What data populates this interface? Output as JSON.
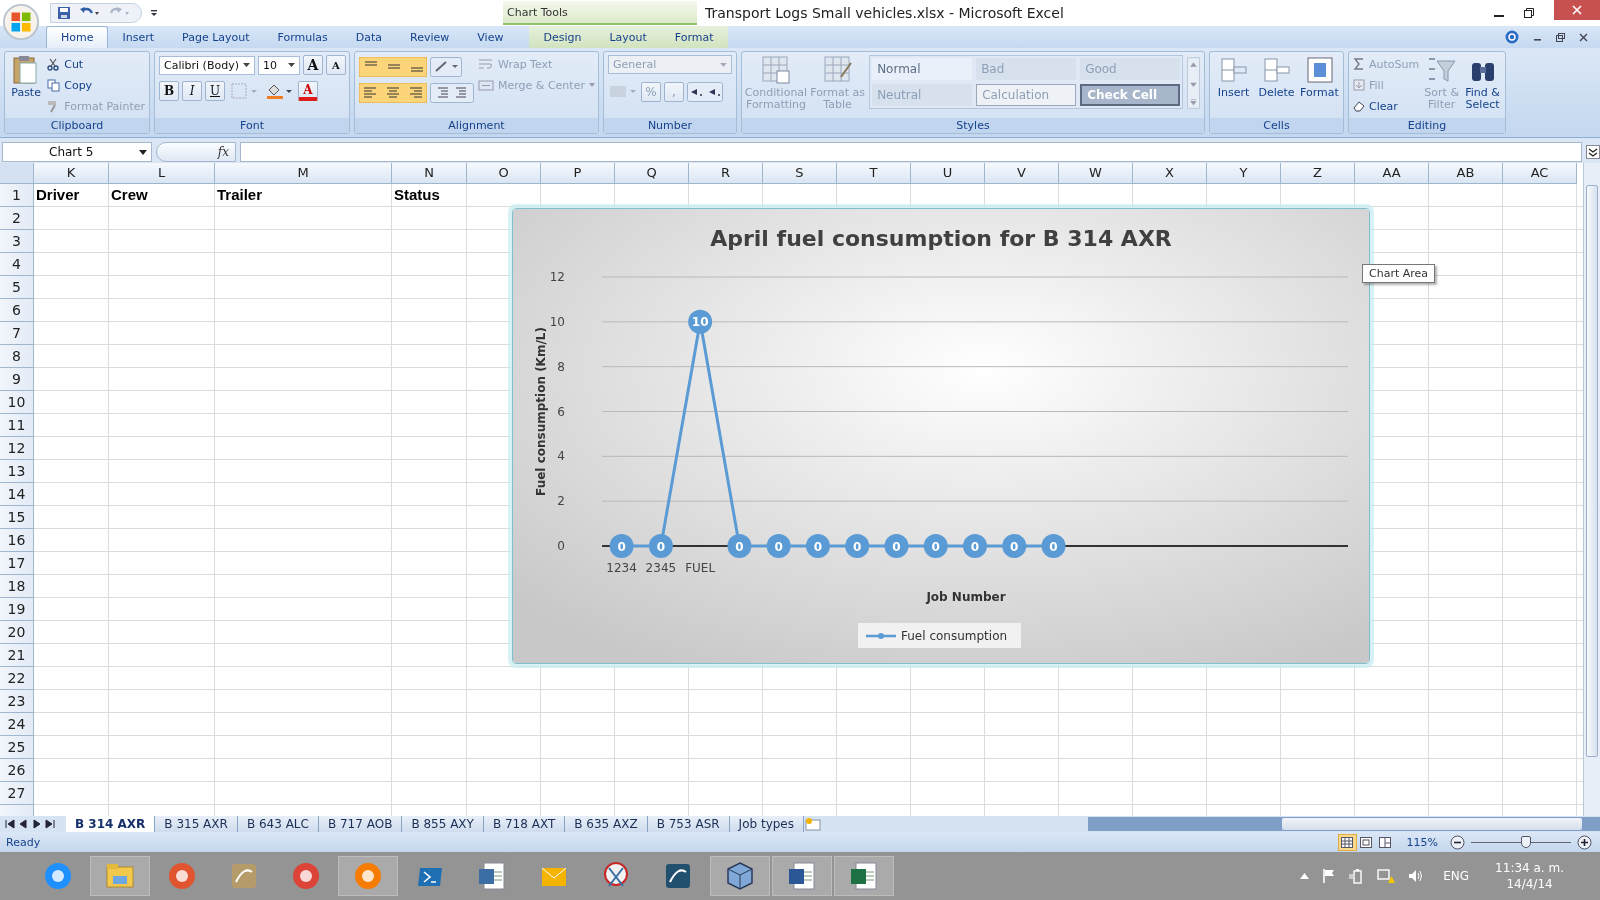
{
  "window": {
    "title": "Transport Logs Small vehicles.xlsx - Microsoft Excel",
    "context_tab": "Chart Tools"
  },
  "tabs": [
    {
      "label": "Home",
      "selected": true,
      "contextual": false
    },
    {
      "label": "Insert",
      "selected": false,
      "contextual": false
    },
    {
      "label": "Page Layout",
      "selected": false,
      "contextual": false
    },
    {
      "label": "Formulas",
      "selected": false,
      "contextual": false
    },
    {
      "label": "Data",
      "selected": false,
      "contextual": false
    },
    {
      "label": "Review",
      "selected": false,
      "contextual": false
    },
    {
      "label": "View",
      "selected": false,
      "contextual": false
    },
    {
      "label": "Design",
      "selected": false,
      "contextual": true
    },
    {
      "label": "Layout",
      "selected": false,
      "contextual": true
    },
    {
      "label": "Format",
      "selected": false,
      "contextual": true
    }
  ],
  "clipboard": {
    "label": "Clipboard",
    "paste": {
      "label": "Paste",
      "disabled": false
    },
    "items": [
      {
        "label": "Cut",
        "disabled": false
      },
      {
        "label": "Copy",
        "disabled": false
      },
      {
        "label": "Format Painter",
        "disabled": true
      }
    ]
  },
  "font": {
    "label": "Font",
    "font_name": "Calibri (Body)",
    "font_size": "10",
    "grow": "A",
    "shrink": "A",
    "styles": [
      "B",
      "I",
      "U"
    ],
    "font_color": "A"
  },
  "alignment": {
    "label": "Alignment",
    "wrap": {
      "label": "Wrap Text",
      "disabled": true
    },
    "merge": {
      "label": "Merge & Center",
      "disabled": true
    }
  },
  "number": {
    "label": "Number",
    "format": "General",
    "disabled": true,
    "symbols": [
      "%",
      ","
    ]
  },
  "styles": {
    "label": "Styles",
    "buttons": [
      {
        "label": "Conditional Formatting",
        "disabled": true
      },
      {
        "label": "Format as Table",
        "disabled": true
      }
    ],
    "cells": [
      {
        "label": "Normal",
        "kind": "normal"
      },
      {
        "label": "Bad",
        "kind": "plain"
      },
      {
        "label": "Good",
        "kind": "plain"
      },
      {
        "label": "Neutral",
        "kind": "plain"
      },
      {
        "label": "Calculation",
        "kind": "calculation"
      },
      {
        "label": "Check Cell",
        "kind": "check"
      }
    ]
  },
  "cells_group": {
    "label": "Cells",
    "buttons": [
      {
        "label": "Insert",
        "disabled": false
      },
      {
        "label": "Delete",
        "disabled": false
      },
      {
        "label": "Format",
        "disabled": false
      }
    ]
  },
  "editing": {
    "label": "Editing",
    "small": [
      {
        "label": "AutoSum",
        "disabled": true
      },
      {
        "label": "Fill",
        "disabled": true
      },
      {
        "label": "Clear",
        "disabled": false
      }
    ],
    "big": [
      {
        "label": "Sort & Filter",
        "disabled": true
      },
      {
        "label": "Find & Select",
        "disabled": false
      }
    ]
  },
  "formula_bar": {
    "name_box": "Chart 5",
    "fx": "fx"
  },
  "sheet": {
    "columns": [
      "K",
      "L",
      "M",
      "N",
      "O",
      "P",
      "Q",
      "R",
      "S",
      "T",
      "U",
      "V",
      "W",
      "X",
      "Y",
      "Z",
      "AA",
      "AB",
      "AC"
    ],
    "rows": [
      "1",
      "2",
      "3",
      "4",
      "5",
      "6",
      "7",
      "8",
      "9",
      "10",
      "11",
      "12",
      "13",
      "14",
      "15",
      "16",
      "17",
      "18",
      "19",
      "20",
      "21",
      "22",
      "23",
      "24",
      "25",
      "26",
      "27"
    ],
    "header_row": [
      "Driver",
      "Crew",
      "Trailer",
      "Status"
    ]
  },
  "chart": {
    "tooltip": "Chart Area",
    "chart_data": {
      "type": "line",
      "title": "April fuel consumption for B 314 AXR",
      "xlabel": "Job Number",
      "ylabel": "Fuel consumption (Km/L)",
      "categories": [
        "1234",
        "2345",
        "FUEL",
        null,
        null,
        null,
        null,
        null,
        null,
        null,
        null,
        null,
        null,
        null,
        null,
        null,
        null,
        null,
        null
      ],
      "series": [
        {
          "name": "Fuel consumption",
          "color": "#5b9bd5",
          "marker": "circle",
          "values": [
            0,
            0,
            10,
            0,
            0,
            0,
            0,
            0,
            0,
            0,
            0,
            0,
            null,
            null,
            null,
            null,
            null,
            null,
            null
          ]
        }
      ],
      "ylim": [
        0,
        12
      ],
      "yticks": [
        0,
        2,
        4,
        6,
        8,
        10,
        12
      ],
      "grid": true,
      "data_labels": true
    }
  },
  "sheet_tabs": [
    {
      "label": "B 314 AXR",
      "selected": true
    },
    {
      "label": "B 315 AXR",
      "selected": false
    },
    {
      "label": "B 643 ALC",
      "selected": false
    },
    {
      "label": "B 717 AOB",
      "selected": false
    },
    {
      "label": "B 855 AXY",
      "selected": false
    },
    {
      "label": "B 718 AXT",
      "selected": false
    },
    {
      "label": "B 635 AXZ",
      "selected": false
    },
    {
      "label": "B 753 ASR",
      "selected": false
    },
    {
      "label": "Job types",
      "selected": false
    }
  ],
  "status_bar": {
    "status": "Ready",
    "views": [
      {
        "selected": true
      },
      {
        "selected": false
      },
      {
        "selected": false
      }
    ],
    "zoom": "115%",
    "level": 0.55
  },
  "taskbar": [
    {
      "kind": "globe",
      "open": false
    },
    {
      "kind": "folder",
      "open": true
    },
    {
      "kind": "disc",
      "open": false
    },
    {
      "kind": "scroll",
      "open": false
    },
    {
      "kind": "wheel",
      "open": false
    },
    {
      "kind": "fox",
      "open": true
    },
    {
      "kind": "terminal",
      "open": false
    },
    {
      "kind": "script",
      "open": false
    },
    {
      "kind": "mail",
      "open": false
    },
    {
      "kind": "scissors",
      "open": false
    },
    {
      "kind": "dolphin",
      "open": false
    },
    {
      "kind": "cube",
      "open": true
    },
    {
      "kind": "document",
      "open": true
    },
    {
      "kind": "sheet",
      "open": true
    }
  ],
  "tray": {
    "language": "ENG",
    "time": "11:34 a. m.",
    "date": "14/4/14"
  }
}
